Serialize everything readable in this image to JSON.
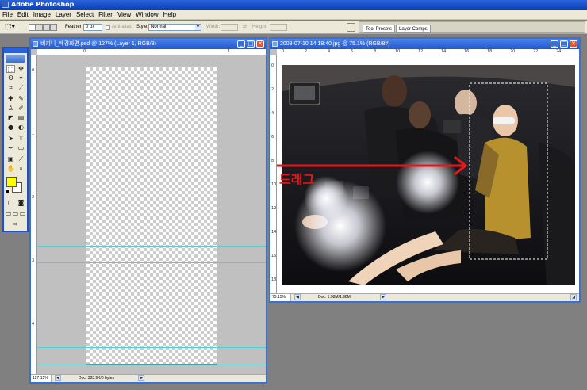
{
  "app": {
    "title": "Adobe Photoshop"
  },
  "menu": [
    "File",
    "Edit",
    "Image",
    "Layer",
    "Select",
    "Filter",
    "View",
    "Window",
    "Help"
  ],
  "options": {
    "feather_label": "Feather:",
    "feather_value": "0 px",
    "antialias_label": "Anti-alias",
    "style_label": "Style:",
    "style_value": "Normal",
    "width_label": "Width:",
    "height_label": "Height:"
  },
  "palette_tabs": [
    "Tool Presets",
    "Layer Comps"
  ],
  "doc_left": {
    "title": "비키니_배경화면.psd @ 127% (Layer 1, RGB/8)",
    "zoom": "127.15%",
    "doc_info": "Doc: 383.9K/0 bytes",
    "ruler_h": [
      "0",
      "1"
    ],
    "ruler_v": [
      "0",
      "1",
      "2",
      "3",
      "4"
    ]
  },
  "doc_right": {
    "title": "2008-07-10 14:18:40.jpg @ 75.1% (RGB/8#)",
    "zoom": "75.15%",
    "doc_info": "Doc: 1.98M/1.98M",
    "ruler_h": [
      "0",
      "2",
      "4",
      "6",
      "8",
      "10",
      "12",
      "14",
      "16",
      "18",
      "20",
      "22",
      "24"
    ],
    "ruler_v": [
      "0",
      "2",
      "4",
      "6",
      "8",
      "10",
      "12",
      "14",
      "16",
      "18"
    ]
  },
  "annotation": {
    "text": "드래그",
    "color": "#e8161b"
  },
  "colors": {
    "foreground": "#ffff00",
    "background": "#ffffff",
    "titlebar": "#2158cf"
  },
  "icons": [
    "marquee-icon",
    "move-icon",
    "lasso-icon",
    "magic-wand-icon",
    "crop-icon",
    "slice-icon",
    "healing-icon",
    "brush-icon",
    "stamp-icon",
    "history-brush-icon",
    "eraser-icon",
    "gradient-icon",
    "blur-icon",
    "dodge-icon",
    "path-select-icon",
    "type-icon",
    "pen-icon",
    "shape-icon",
    "notes-icon",
    "eyedropper-icon",
    "hand-icon",
    "zoom-icon"
  ]
}
